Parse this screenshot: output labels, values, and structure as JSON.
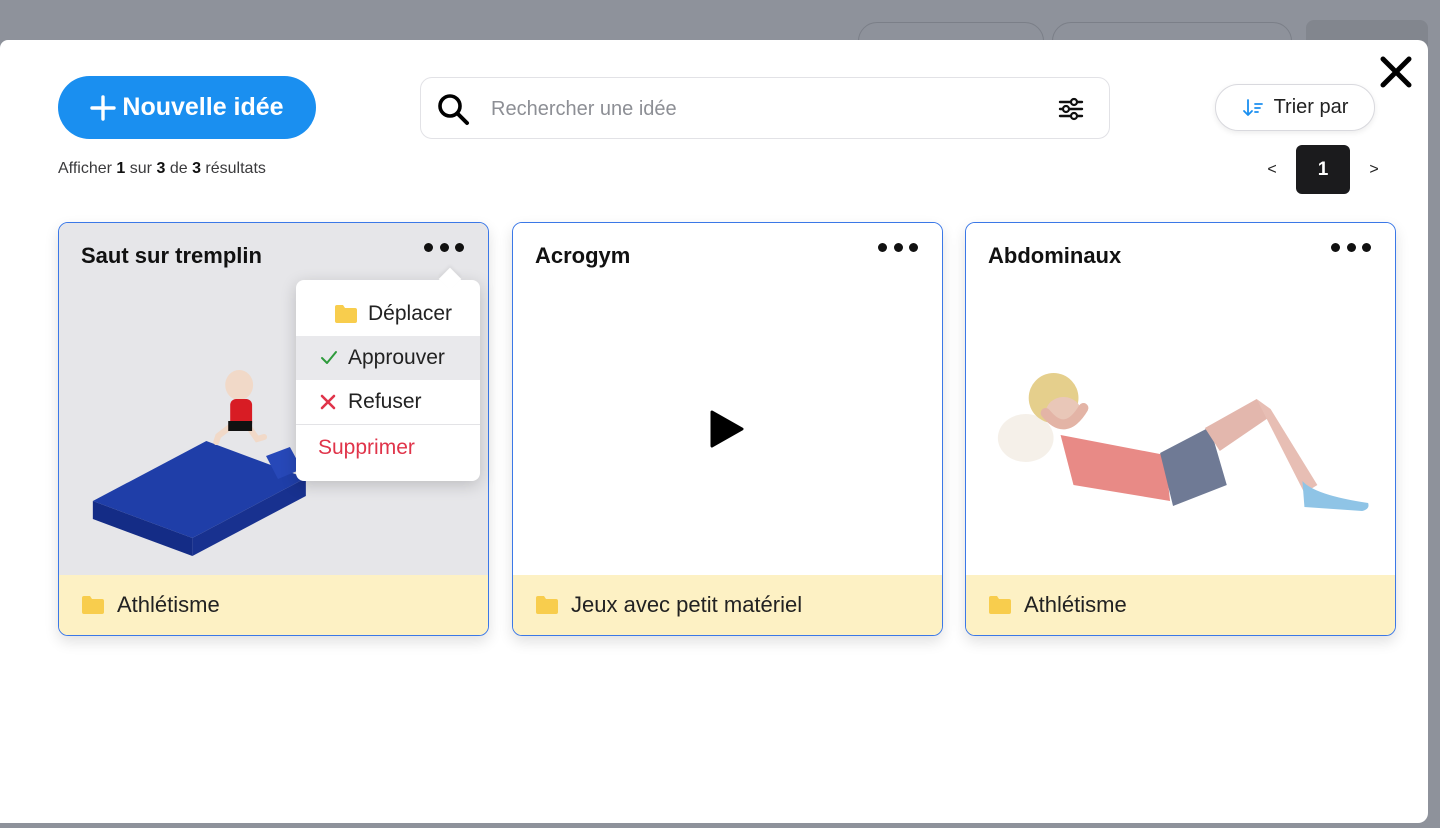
{
  "modal": {
    "new_idea_label": "Nouvelle idée",
    "search_placeholder": "Rechercher une idée",
    "sort_label": "Trier par",
    "results": {
      "prefix": "Afficher",
      "shown": "1",
      "middle": "sur",
      "total_pages": "3",
      "of": "de",
      "count": "3",
      "suffix": "résultats"
    },
    "pagination": {
      "prev": "<",
      "current": "1",
      "next": ">"
    }
  },
  "cards": [
    {
      "title": "Saut sur tremplin",
      "category": "Athlétisme",
      "media": "trampoline-jump-image"
    },
    {
      "title": "Acrogym",
      "category": "Jeux avec petit matériel",
      "media": "video-play"
    },
    {
      "title": "Abdominaux",
      "category": "Athlétisme",
      "media": "situp-image"
    }
  ],
  "context_menu": {
    "items": [
      {
        "label": "Déplacer",
        "icon": "folder-icon"
      },
      {
        "label": "Approuver",
        "icon": "check-icon"
      },
      {
        "label": "Refuser",
        "icon": "cross-icon"
      },
      {
        "label": "Supprimer",
        "icon": ""
      }
    ]
  },
  "colors": {
    "accent": "#1a8ff0",
    "card_border": "#3b78e7",
    "footer_bg": "#fdf1c4",
    "danger": "#e0344a",
    "approve": "#2e9b3c",
    "folder": "#f8cd4d"
  }
}
